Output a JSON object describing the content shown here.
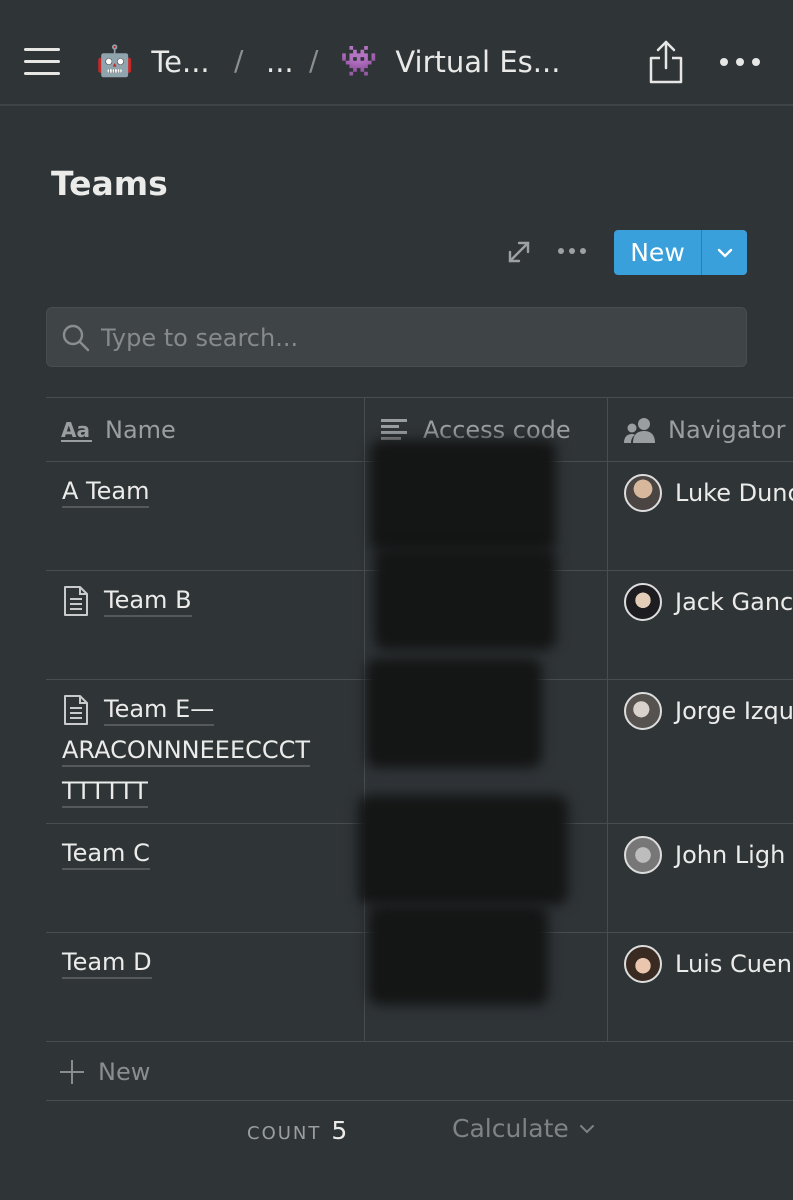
{
  "topbar": {
    "crumb1_emoji": "🤖",
    "crumb1_label": "Te...",
    "separator": "/",
    "crumb2_label": "...",
    "crumb3_emoji": "👾",
    "crumb3_label": "Virtual Es..."
  },
  "page": {
    "title": "Teams"
  },
  "toolbar": {
    "new_label": "New"
  },
  "search": {
    "placeholder": "Type to search..."
  },
  "table": {
    "columns": [
      {
        "label": "Name",
        "icon": "text-aa-icon"
      },
      {
        "label": "Access code",
        "icon": "text-lines-icon"
      },
      {
        "label": "Navigator",
        "icon": "person-icon"
      }
    ],
    "rows": [
      {
        "name": "A Team",
        "has_page_icon": false,
        "navigator": "Luke Dunc"
      },
      {
        "name": "Team B",
        "has_page_icon": true,
        "navigator": "Jack Ganc"
      },
      {
        "name_line1": "Team E—",
        "name_line2": "ARACONNNEEECCCT",
        "name_line3": "TTTTTT",
        "has_page_icon": true,
        "navigator": "Jorge Izqu"
      },
      {
        "name": "Team C",
        "has_page_icon": false,
        "navigator": "John Ligh"
      },
      {
        "name": "Team D",
        "has_page_icon": false,
        "navigator": "Luis Cuen"
      }
    ],
    "add_row_label": "New"
  },
  "footer": {
    "count_label": "COUNT",
    "count_value": "5",
    "calculate_label": "Calculate"
  }
}
